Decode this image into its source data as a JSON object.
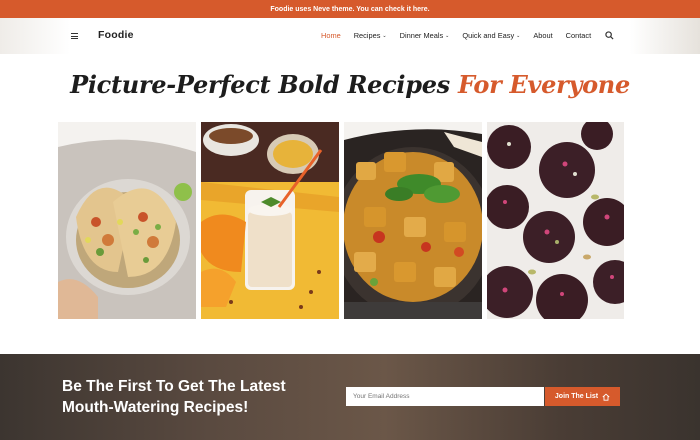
{
  "topbar": {
    "text": "Foodie uses Neve theme. You can check it here."
  },
  "header": {
    "logo": "Foodie",
    "menu_icon": "hamburger-menu-icon",
    "search_icon": "search-icon",
    "nav": [
      {
        "label": "Home",
        "active": true,
        "dropdown": false
      },
      {
        "label": "Recipes",
        "active": false,
        "dropdown": true
      },
      {
        "label": "Dinner Meals",
        "active": false,
        "dropdown": true
      },
      {
        "label": "Quick and Easy",
        "active": false,
        "dropdown": true
      },
      {
        "label": "About",
        "active": false,
        "dropdown": false
      },
      {
        "label": "Contact",
        "active": false,
        "dropdown": false
      }
    ]
  },
  "hero": {
    "title_part1": "Picture-Perfect Bold Recipes",
    "title_part2": "For Everyone"
  },
  "gallery": [
    {
      "name": "tacos"
    },
    {
      "name": "smoothie"
    },
    {
      "name": "tofu-stir-fry"
    },
    {
      "name": "chocolate-discs"
    }
  ],
  "newsletter": {
    "line1": "Be The First To Get The Latest",
    "line2": "Mouth-Watering Recipes!",
    "placeholder": "Your Email Address",
    "button_label": "Join The List",
    "button_icon": "home-icon"
  },
  "colors": {
    "accent": "#d65a2c",
    "dark": "#1d1d1d"
  }
}
